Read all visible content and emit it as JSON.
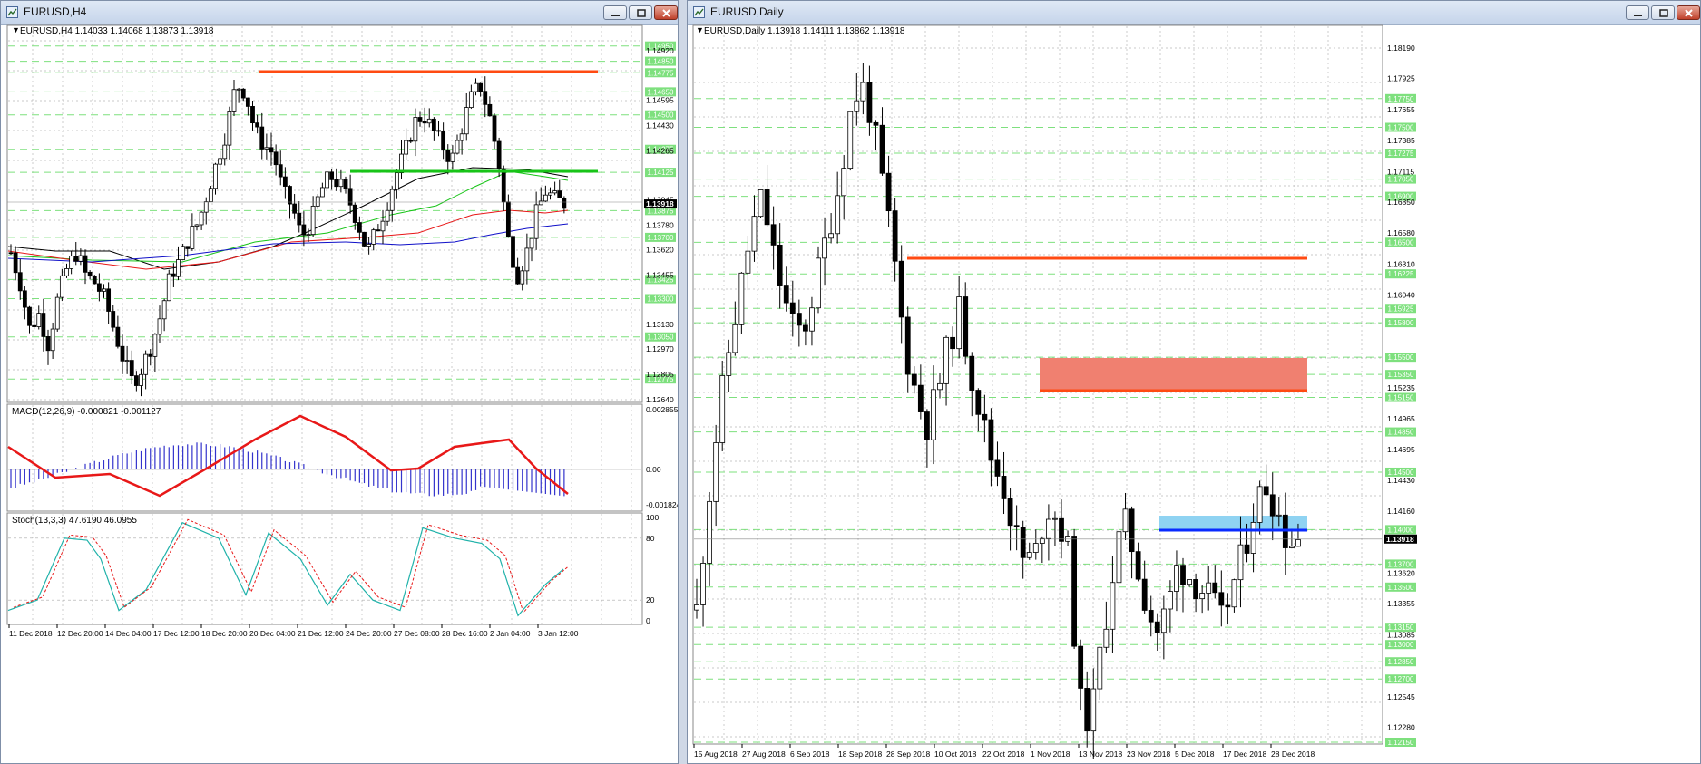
{
  "left_window": {
    "title": "EURUSD,H4",
    "header": "EURUSD,H4  1.14033 1.14068 1.13873 1.13918",
    "macd_label": "MACD(12,26,9) -0.000821 -0.001127",
    "stoch_label": "Stoch(13,3,3) 47.6190 46.0955",
    "price_scale": [
      "1.14920",
      "1.14595",
      "1.14430",
      "1.14265",
      "1.13945",
      "1.13780",
      "1.13620",
      "1.13455",
      "1.13130",
      "1.12970",
      "1.12805",
      "1.12640"
    ],
    "green_levels": [
      "1.14950",
      "1.14850",
      "1.14775",
      "1.14650",
      "1.14500",
      "1.14275",
      "1.14125",
      "1.13875",
      "1.13700",
      "1.13425",
      "1.13300",
      "1.13050",
      "1.12775"
    ],
    "current_price": "1.13918",
    "macd_scale": [
      "0.002855",
      "0.00",
      "-0.001824"
    ],
    "stoch_scale": [
      "100",
      "80",
      "20",
      "0"
    ],
    "time_axis": [
      "11 Dec 2018",
      "12 Dec 20:00",
      "14 Dec 04:00",
      "17 Dec 12:00",
      "18 Dec 20:00",
      "20 Dec 04:00",
      "21 Dec 12:00",
      "24 Dec 20:00",
      "27 Dec 08:00",
      "28 Dec 16:00",
      "2 Jan 04:00",
      "3 Jan 12:00"
    ]
  },
  "right_window": {
    "title": "EURUSD,Daily",
    "header": "EURUSD,Daily  1.13918 1.14111 1.13862 1.13918",
    "price_scale": [
      "1.18190",
      "1.17925",
      "1.17655",
      "1.17385",
      "1.17115",
      "1.16850",
      "1.16580",
      "1.16310",
      "1.16040",
      "1.15235",
      "1.14965",
      "1.14695",
      "1.14430",
      "1.14160",
      "1.13620",
      "1.13355",
      "1.13085",
      "1.12545",
      "1.12280"
    ],
    "green_levels": [
      "1.17750",
      "1.17500",
      "1.17275",
      "1.17050",
      "1.16900",
      "1.16500",
      "1.16225",
      "1.15925",
      "1.15800",
      "1.15500",
      "1.15350",
      "1.15150",
      "1.14850",
      "1.14500",
      "1.14000",
      "1.13700",
      "1.13500",
      "1.13150",
      "1.13000",
      "1.12850",
      "1.12700",
      "1.12150"
    ],
    "current_price": "1.13918",
    "time_axis": [
      "15 Aug 2018",
      "27 Aug 2018",
      "6 Sep 2018",
      "18 Sep 2018",
      "28 Sep 2018",
      "10 Oct 2018",
      "22 Oct 2018",
      "1 Nov 2018",
      "13 Nov 2018",
      "23 Nov 2018",
      "5 Dec 2018",
      "17 Dec 2018",
      "28 Dec 2018"
    ]
  },
  "colors": {
    "resistance": "#ff4a12",
    "support_green": "#18c418",
    "support_blue": "#0a2bff",
    "zone_red": "#f08070",
    "zone_blue": "#8fd3f2",
    "level_line": "#7ee07e",
    "macd_signal": "#e81818",
    "macd_hist": "#3333cc",
    "stoch_main": "#20b2aa",
    "stoch_signal": "#e81818"
  }
}
